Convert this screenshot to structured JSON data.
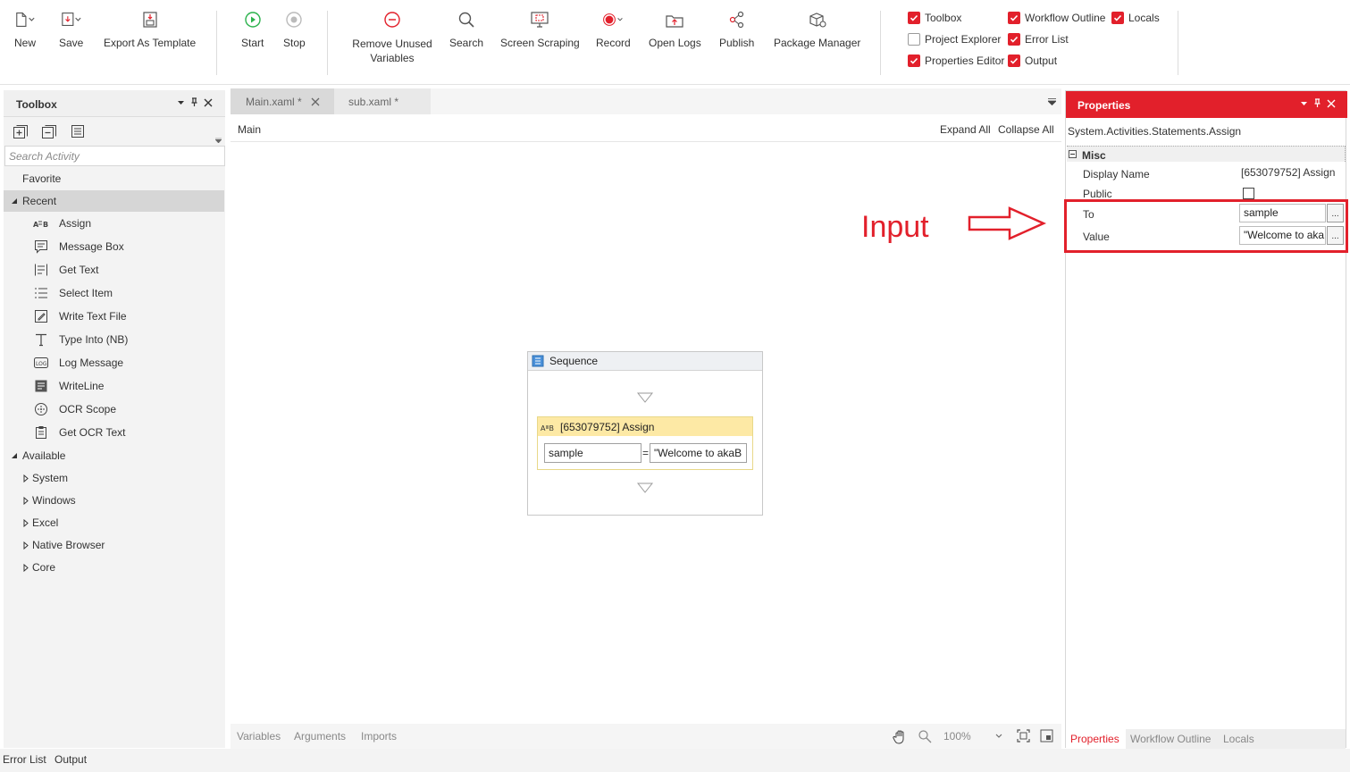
{
  "ribbon": {
    "buttons": [
      {
        "label": "New",
        "icon": "new-file-icon"
      },
      {
        "label": "Save",
        "icon": "save-icon"
      },
      {
        "label": "Export As Template",
        "icon": "export-template-icon"
      },
      {
        "label": "Start",
        "icon": "play-icon"
      },
      {
        "label": "Stop",
        "icon": "stop-icon"
      },
      {
        "label": "Remove Unused Variables",
        "icon": "remove-icon"
      },
      {
        "label": "Search",
        "icon": "search-icon"
      },
      {
        "label": "Screen Scraping",
        "icon": "screen-scraping-icon"
      },
      {
        "label": "Record",
        "icon": "record-icon"
      },
      {
        "label": "Open Logs",
        "icon": "open-logs-icon"
      },
      {
        "label": "Publish",
        "icon": "publish-icon"
      },
      {
        "label": "Package Manager",
        "icon": "package-manager-icon"
      }
    ],
    "panes": [
      {
        "label": "Toolbox",
        "checked": true
      },
      {
        "label": "Project Explorer",
        "checked": false
      },
      {
        "label": "Properties Editor",
        "checked": true
      },
      {
        "label": "Workflow Outline",
        "checked": true
      },
      {
        "label": "Error List",
        "checked": true
      },
      {
        "label": "Output",
        "checked": true
      },
      {
        "label": "Locals",
        "checked": true
      }
    ]
  },
  "toolbox": {
    "title": "Toolbox",
    "search_placeholder": "Search Activity",
    "favorite": "Favorite",
    "recent": "Recent",
    "recent_items": [
      "Assign",
      "Message Box",
      "Get Text",
      "Select Item",
      "Write Text File",
      "Type Into (NB)",
      "Log Message",
      "WriteLine",
      "OCR Scope",
      "Get OCR Text"
    ],
    "available": "Available",
    "available_items": [
      "System",
      "Windows",
      "Excel",
      "Native Browser",
      "Core"
    ]
  },
  "designer": {
    "tabs": [
      "Main.xaml *",
      "sub.xaml *"
    ],
    "breadcrumb": "Main",
    "expand_all": "Expand All",
    "collapse_all": "Collapse All",
    "sequence_title": "Sequence",
    "assign_title": "[653079752] Assign",
    "assign_to": "sample",
    "assign_eq": "=",
    "assign_value": "\"Welcome to akaB",
    "footer_tabs": [
      "Variables",
      "Arguments",
      "Imports"
    ],
    "zoom": "100%"
  },
  "annotation": {
    "label": "Input",
    "color": "#e2202b"
  },
  "properties": {
    "title": "Properties",
    "type_name": "System.Activities.Statements.Assign",
    "category": "Misc",
    "rows": [
      {
        "name": "Display Name",
        "value": "[653079752] Assign"
      },
      {
        "name": "Public",
        "value": ""
      },
      {
        "name": "To",
        "value": "sample"
      },
      {
        "name": "Value",
        "value": "\"Welcome to aka"
      }
    ],
    "ellipsis": "...",
    "footer_tabs": [
      "Properties",
      "Workflow Outline",
      "Locals"
    ]
  },
  "bottom_tabs": [
    "Error List",
    "Output"
  ],
  "colors": {
    "accent": "#e2202b",
    "play": "#2bb24c",
    "assign_header": "#fde9a5"
  }
}
